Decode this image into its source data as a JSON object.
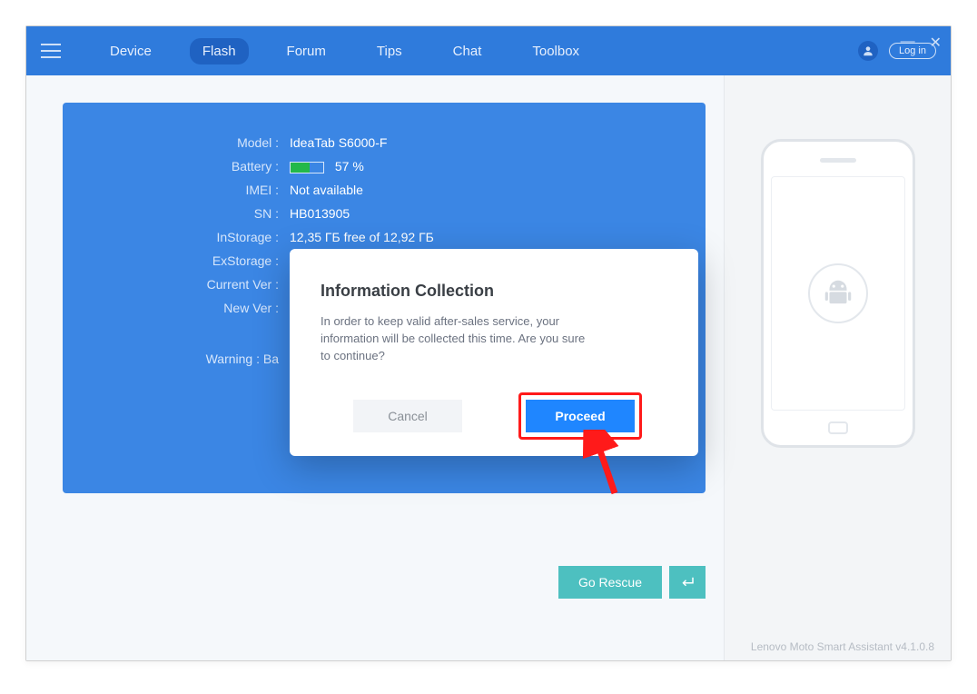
{
  "nav": {
    "items": [
      {
        "label": "Device"
      },
      {
        "label": "Flash"
      },
      {
        "label": "Forum"
      },
      {
        "label": "Tips"
      },
      {
        "label": "Chat"
      },
      {
        "label": "Toolbox"
      }
    ],
    "login": "Log in"
  },
  "device": {
    "fields": [
      {
        "label": "Model :",
        "value": "IdeaTab S6000-F"
      },
      {
        "label": "Battery :",
        "value": "57 %"
      },
      {
        "label": "IMEI :",
        "value": "Not available"
      },
      {
        "label": "SN :",
        "value": "HB013905"
      },
      {
        "label": "InStorage :",
        "value": "12,35 ГБ free of 12,92 ГБ"
      },
      {
        "label": "ExStorage :",
        "value": ""
      },
      {
        "label": "Current Ver :",
        "value": ""
      },
      {
        "label": "New Ver :",
        "value": ""
      }
    ],
    "warning_label": "Warning : Ba"
  },
  "actions": {
    "go_rescue": "Go Rescue"
  },
  "modal": {
    "title": "Information Collection",
    "body": "In order to keep valid after-sales service, your information will be collected this time. Are you sure to continue?",
    "cancel": "Cancel",
    "proceed": "Proceed"
  },
  "footer": "Lenovo Moto Smart Assistant v4.1.0.8"
}
